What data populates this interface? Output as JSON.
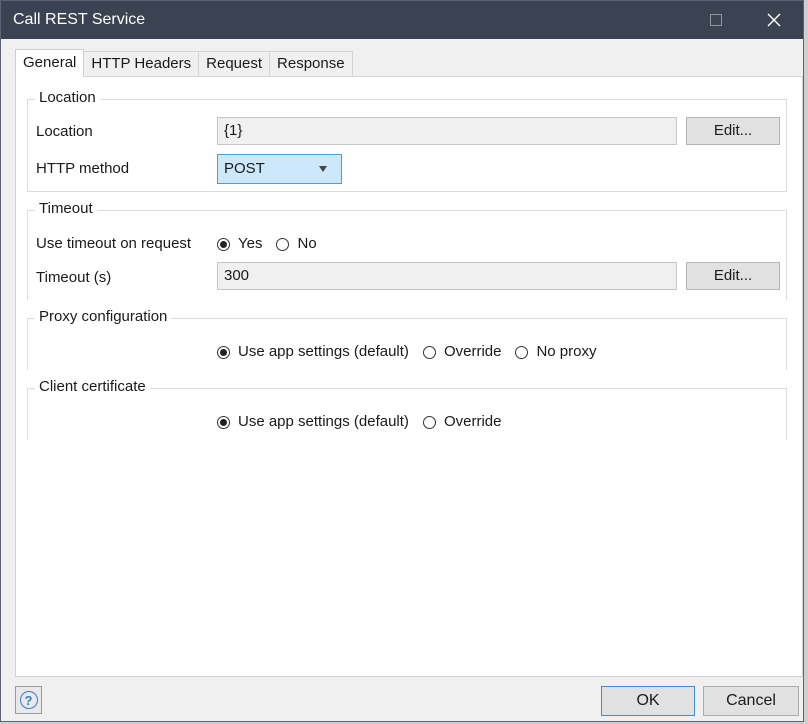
{
  "window": {
    "title": "Call REST Service"
  },
  "tabs": [
    {
      "label": "General",
      "active": true
    },
    {
      "label": "HTTP Headers",
      "active": false
    },
    {
      "label": "Request",
      "active": false
    },
    {
      "label": "Response",
      "active": false
    }
  ],
  "location_group": {
    "legend": "Location",
    "location_label": "Location",
    "location_value": "{1}",
    "location_edit": "Edit...",
    "method_label": "HTTP method",
    "method_value": "POST"
  },
  "timeout_group": {
    "legend": "Timeout",
    "use_timeout_label": "Use timeout on request",
    "yes_label": "Yes",
    "no_label": "No",
    "selected": "Yes",
    "timeout_label": "Timeout (s)",
    "timeout_value": "300",
    "timeout_edit": "Edit..."
  },
  "proxy_group": {
    "legend": "Proxy configuration",
    "options": [
      "Use app settings (default)",
      "Override",
      "No proxy"
    ],
    "selected": "Use app settings (default)"
  },
  "certificate_group": {
    "legend": "Client certificate",
    "options": [
      "Use app settings (default)",
      "Override"
    ],
    "selected": "Use app settings (default)"
  },
  "footer": {
    "help_icon": "help-icon",
    "ok_label": "OK",
    "cancel_label": "Cancel"
  },
  "colors": {
    "titlebar": "#3b4251",
    "select_bg": "#cde8fb",
    "accent": "#3c8fd6"
  }
}
